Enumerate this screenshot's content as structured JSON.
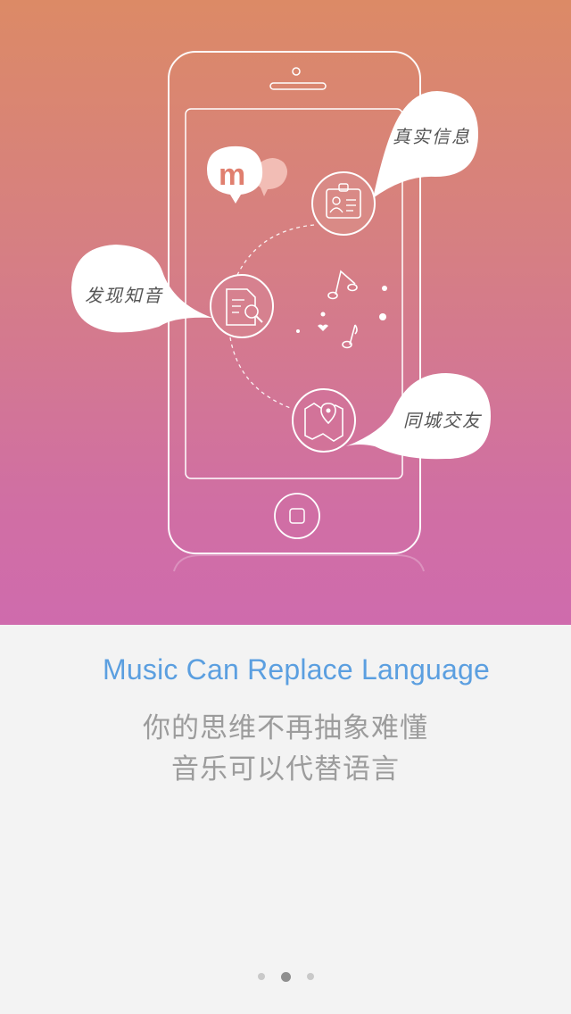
{
  "illustration": {
    "bubbles": [
      {
        "id": "real-info",
        "label": "真实信息",
        "icon": "id-badge-icon"
      },
      {
        "id": "discover",
        "label": "发现知音",
        "icon": "document-search-icon"
      },
      {
        "id": "local-friends",
        "label": "同城交友",
        "icon": "map-pin-icon"
      }
    ],
    "logo": "m-chat-logo"
  },
  "headline": "Music Can Replace Language",
  "subline": [
    "你的思维不再抽象难懂",
    "音乐可以代替语言"
  ],
  "pager": {
    "count": 3,
    "active": 2
  },
  "colors": {
    "headline": "#5b9fe0",
    "hero_top": "#dc8a66",
    "hero_bottom": "#cf6bad"
  }
}
